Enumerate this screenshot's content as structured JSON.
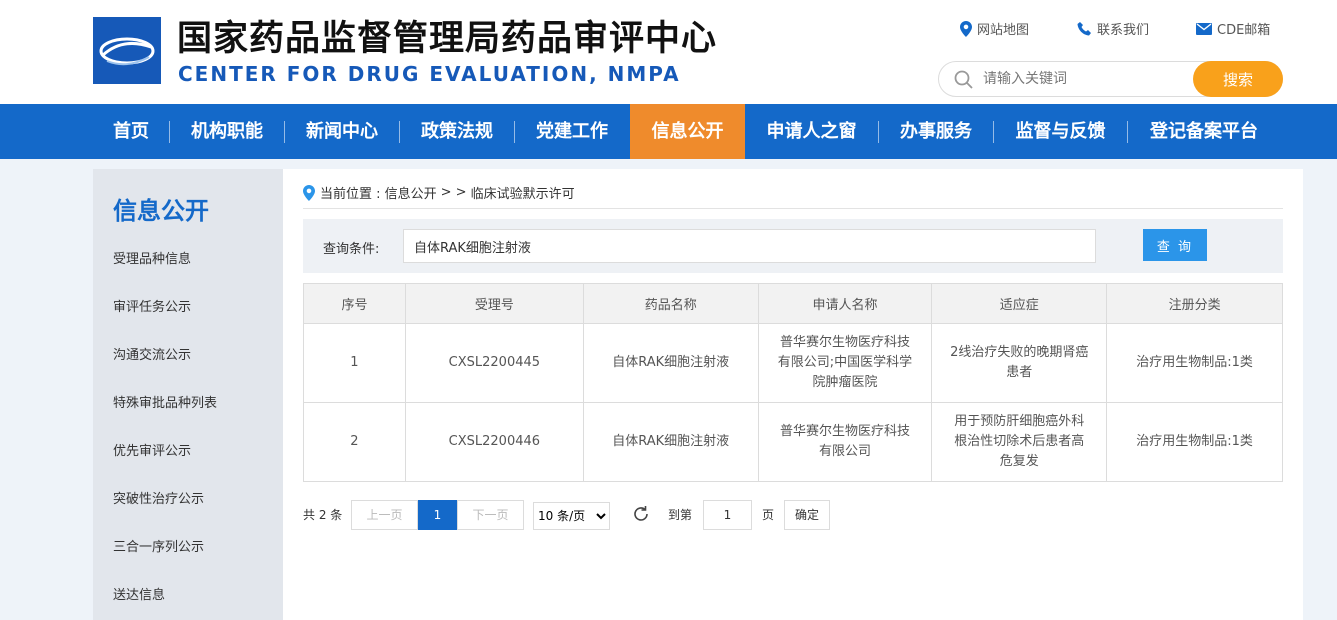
{
  "header": {
    "title_cn": "国家药品监督管理局药品审评中心",
    "title_en": "CENTER FOR DRUG EVALUATION, NMPA",
    "links": [
      {
        "label": "网站地图",
        "icon": "location-pin-icon"
      },
      {
        "label": "联系我们",
        "icon": "phone-icon"
      },
      {
        "label": "CDE邮箱",
        "icon": "mail-icon"
      }
    ],
    "search_placeholder": "请输入关键词",
    "search_button": "搜索"
  },
  "nav": {
    "items": [
      {
        "label": "首页"
      },
      {
        "label": "机构职能"
      },
      {
        "label": "新闻中心"
      },
      {
        "label": "政策法规"
      },
      {
        "label": "党建工作"
      },
      {
        "label": "信息公开",
        "active": true
      },
      {
        "label": "申请人之窗"
      },
      {
        "label": "办事服务"
      },
      {
        "label": "监督与反馈"
      },
      {
        "label": "登记备案平台"
      }
    ]
  },
  "sidebar": {
    "title": "信息公开",
    "items": [
      {
        "label": "受理品种信息"
      },
      {
        "label": "审评任务公示"
      },
      {
        "label": "沟通交流公示"
      },
      {
        "label": "特殊审批品种列表"
      },
      {
        "label": "优先审评公示"
      },
      {
        "label": "突破性治疗公示"
      },
      {
        "label": "三合一序列公示"
      },
      {
        "label": "送达信息"
      }
    ]
  },
  "breadcrumb": {
    "prefix": "当前位置 : 信息公开",
    "sep": "> >",
    "current": "临床试验默示许可"
  },
  "query": {
    "label": "查询条件:",
    "value": "自体RAK细胞注射液",
    "button": "查 询"
  },
  "table": {
    "headers": [
      "序号",
      "受理号",
      "药品名称",
      "申请人名称",
      "适应症",
      "注册分类"
    ],
    "rows": [
      [
        "1",
        "CXSL2200445",
        "自体RAK细胞注射液",
        "普华赛尔生物医疗科技有限公司;中国医学科学院肿瘤医院",
        "2线治疗失败的晚期肾癌患者",
        "治疗用生物制品:1类"
      ],
      [
        "2",
        "CXSL2200446",
        "自体RAK细胞注射液",
        "普华赛尔生物医疗科技有限公司",
        "用于预防肝细胞癌外科根治性切除术后患者高危复发",
        "治疗用生物制品:1类"
      ]
    ]
  },
  "pager": {
    "total": "共 2 条",
    "prev": "上一页",
    "current": "1",
    "next": "下一页",
    "page_size": "10 条/页",
    "goto_label": "到第",
    "goto_value": "1",
    "page_unit": "页",
    "confirm": "确定"
  },
  "colors": {
    "nav_blue": "#1469c9",
    "active_orange": "#ef8b2c",
    "search_orange": "#f9a11b",
    "query_blue": "#2b95e9"
  }
}
